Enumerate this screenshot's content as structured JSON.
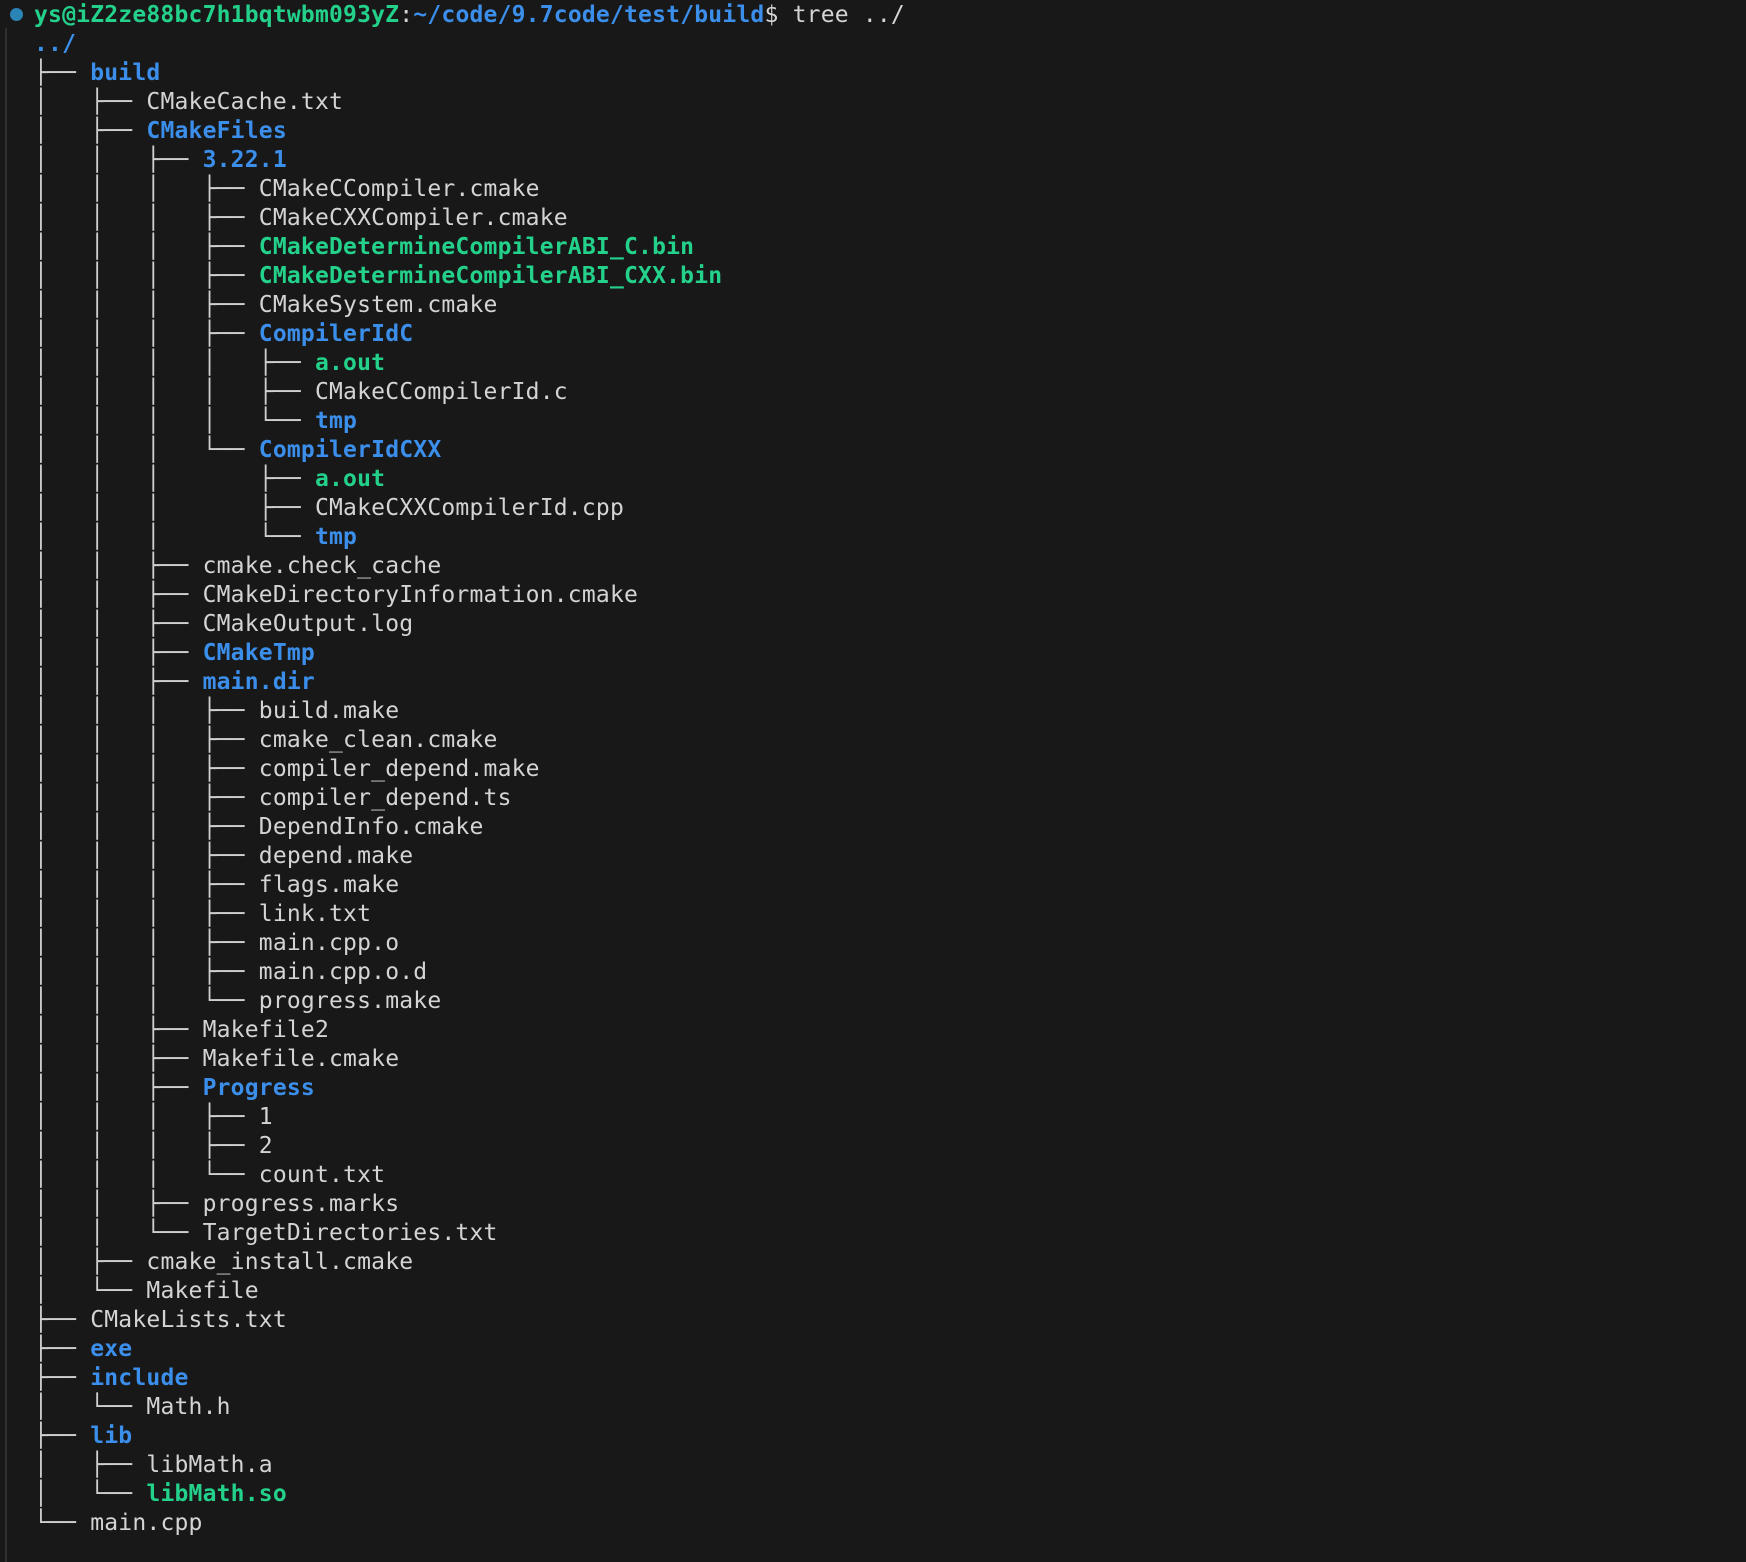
{
  "prompt": {
    "user_host": "ys@iZ2ze88bc7h1bqtwbm093yZ",
    "separator": ":",
    "cwd": "~/code/9.7code/test/build",
    "symbol": "$",
    "command": " tree ../"
  },
  "root": "../",
  "lines": [
    {
      "prefix": "├── ",
      "name": "build",
      "type": "dir"
    },
    {
      "prefix": "│   ├── ",
      "name": "CMakeCache.txt",
      "type": "file"
    },
    {
      "prefix": "│   ├── ",
      "name": "CMakeFiles",
      "type": "dir"
    },
    {
      "prefix": "│   │   ├── ",
      "name": "3.22.1",
      "type": "dir"
    },
    {
      "prefix": "│   │   │   ├── ",
      "name": "CMakeCCompiler.cmake",
      "type": "file"
    },
    {
      "prefix": "│   │   │   ├── ",
      "name": "CMakeCXXCompiler.cmake",
      "type": "file"
    },
    {
      "prefix": "│   │   │   ├── ",
      "name": "CMakeDetermineCompilerABI_C.bin",
      "type": "exec"
    },
    {
      "prefix": "│   │   │   ├── ",
      "name": "CMakeDetermineCompilerABI_CXX.bin",
      "type": "exec"
    },
    {
      "prefix": "│   │   │   ├── ",
      "name": "CMakeSystem.cmake",
      "type": "file"
    },
    {
      "prefix": "│   │   │   ├── ",
      "name": "CompilerIdC",
      "type": "dir"
    },
    {
      "prefix": "│   │   │   │   ├── ",
      "name": "a.out",
      "type": "exec"
    },
    {
      "prefix": "│   │   │   │   ├── ",
      "name": "CMakeCCompilerId.c",
      "type": "file"
    },
    {
      "prefix": "│   │   │   │   └── ",
      "name": "tmp",
      "type": "dir"
    },
    {
      "prefix": "│   │   │   └── ",
      "name": "CompilerIdCXX",
      "type": "dir"
    },
    {
      "prefix": "│   │   │       ├── ",
      "name": "a.out",
      "type": "exec"
    },
    {
      "prefix": "│   │   │       ├── ",
      "name": "CMakeCXXCompilerId.cpp",
      "type": "file"
    },
    {
      "prefix": "│   │   │       └── ",
      "name": "tmp",
      "type": "dir"
    },
    {
      "prefix": "│   │   ├── ",
      "name": "cmake.check_cache",
      "type": "file"
    },
    {
      "prefix": "│   │   ├── ",
      "name": "CMakeDirectoryInformation.cmake",
      "type": "file"
    },
    {
      "prefix": "│   │   ├── ",
      "name": "CMakeOutput.log",
      "type": "file"
    },
    {
      "prefix": "│   │   ├── ",
      "name": "CMakeTmp",
      "type": "dir"
    },
    {
      "prefix": "│   │   ├── ",
      "name": "main.dir",
      "type": "dir"
    },
    {
      "prefix": "│   │   │   ├── ",
      "name": "build.make",
      "type": "file"
    },
    {
      "prefix": "│   │   │   ├── ",
      "name": "cmake_clean.cmake",
      "type": "file"
    },
    {
      "prefix": "│   │   │   ├── ",
      "name": "compiler_depend.make",
      "type": "file"
    },
    {
      "prefix": "│   │   │   ├── ",
      "name": "compiler_depend.ts",
      "type": "file"
    },
    {
      "prefix": "│   │   │   ├── ",
      "name": "DependInfo.cmake",
      "type": "file"
    },
    {
      "prefix": "│   │   │   ├── ",
      "name": "depend.make",
      "type": "file"
    },
    {
      "prefix": "│   │   │   ├── ",
      "name": "flags.make",
      "type": "file"
    },
    {
      "prefix": "│   │   │   ├── ",
      "name": "link.txt",
      "type": "file"
    },
    {
      "prefix": "│   │   │   ├── ",
      "name": "main.cpp.o",
      "type": "file"
    },
    {
      "prefix": "│   │   │   ├── ",
      "name": "main.cpp.o.d",
      "type": "file"
    },
    {
      "prefix": "│   │   │   └── ",
      "name": "progress.make",
      "type": "file"
    },
    {
      "prefix": "│   │   ├── ",
      "name": "Makefile2",
      "type": "file"
    },
    {
      "prefix": "│   │   ├── ",
      "name": "Makefile.cmake",
      "type": "file"
    },
    {
      "prefix": "│   │   ├── ",
      "name": "Progress",
      "type": "dir"
    },
    {
      "prefix": "│   │   │   ├── ",
      "name": "1",
      "type": "file"
    },
    {
      "prefix": "│   │   │   ├── ",
      "name": "2",
      "type": "file"
    },
    {
      "prefix": "│   │   │   └── ",
      "name": "count.txt",
      "type": "file"
    },
    {
      "prefix": "│   │   ├── ",
      "name": "progress.marks",
      "type": "file"
    },
    {
      "prefix": "│   │   └── ",
      "name": "TargetDirectories.txt",
      "type": "file"
    },
    {
      "prefix": "│   ├── ",
      "name": "cmake_install.cmake",
      "type": "file"
    },
    {
      "prefix": "│   └── ",
      "name": "Makefile",
      "type": "file"
    },
    {
      "prefix": "├── ",
      "name": "CMakeLists.txt",
      "type": "file"
    },
    {
      "prefix": "├── ",
      "name": "exe",
      "type": "dir"
    },
    {
      "prefix": "├── ",
      "name": "include",
      "type": "dir"
    },
    {
      "prefix": "│   └── ",
      "name": "Math.h",
      "type": "file"
    },
    {
      "prefix": "├── ",
      "name": "lib",
      "type": "dir"
    },
    {
      "prefix": "│   ├── ",
      "name": "libMath.a",
      "type": "file"
    },
    {
      "prefix": "│   └── ",
      "name": "libMath.so",
      "type": "exec"
    },
    {
      "prefix": "└── ",
      "name": "main.cpp",
      "type": "file"
    }
  ],
  "colors": {
    "background": "#181818",
    "file": "#d4d4d4",
    "dir": "#3b8eea",
    "exec": "#23d18b",
    "prompt_dot": "#2a84b6"
  }
}
